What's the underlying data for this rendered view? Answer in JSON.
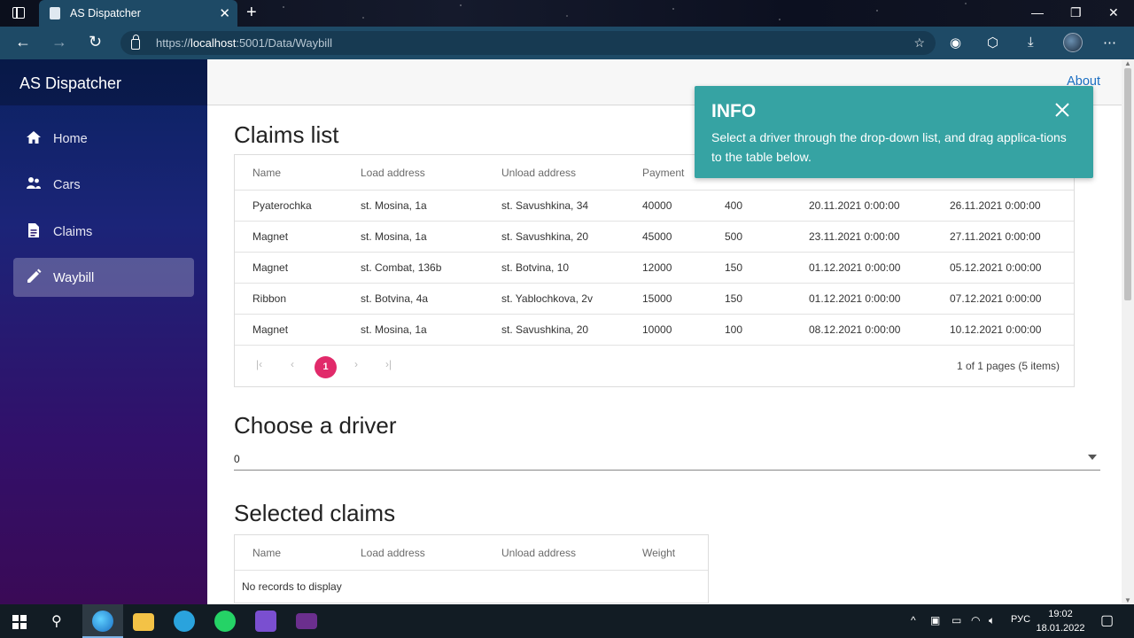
{
  "browser": {
    "tab_title": "AS Dispatcher",
    "url_prefix": "https://",
    "url_host": "localhost",
    "url_rest": ":5001/Data/Waybill"
  },
  "sidebar": {
    "brand": "AS Dispatcher",
    "items": [
      {
        "label": "Home",
        "icon": "home-icon"
      },
      {
        "label": "Cars",
        "icon": "people-icon"
      },
      {
        "label": "Claims",
        "icon": "document-icon"
      },
      {
        "label": "Waybill",
        "icon": "pencil-icon"
      }
    ],
    "active": "Waybill"
  },
  "header": {
    "about": "About"
  },
  "claims": {
    "title": "Claims list",
    "columns": [
      "Name",
      "Load address",
      "Unload address",
      "Payment"
    ],
    "rows": [
      [
        "Pyaterochka",
        "st. Mosina, 1a",
        "st. Savushkina, 34",
        "40000",
        "400",
        "20.11.2021 0:00:00",
        "26.11.2021 0:00:00"
      ],
      [
        "Magnet",
        "st. Mosina, 1a",
        "st. Savushkina, 20",
        "45000",
        "500",
        "23.11.2021 0:00:00",
        "27.11.2021 0:00:00"
      ],
      [
        "Magnet",
        "st. Combat, 136b",
        "st. Botvina, 10",
        "12000",
        "150",
        "01.12.2021 0:00:00",
        "05.12.2021 0:00:00"
      ],
      [
        "Ribbon",
        "st. Botvina, 4a",
        "st. Yablochkova, 2v",
        "15000",
        "150",
        "01.12.2021 0:00:00",
        "07.12.2021 0:00:00"
      ],
      [
        "Magnet",
        "st. Mosina, 1a",
        "st. Savushkina, 20",
        "10000",
        "100",
        "08.12.2021 0:00:00",
        "10.12.2021 0:00:00"
      ]
    ],
    "pager": {
      "current_page": "1",
      "info": "1 of 1 pages (5 items)"
    }
  },
  "driver": {
    "title": "Choose a driver",
    "selected": "0"
  },
  "selected_claims": {
    "title": "Selected claims",
    "columns": [
      "Name",
      "Load address",
      "Unload address",
      "Weight"
    ],
    "empty": "No records to display"
  },
  "toast": {
    "title": "INFO",
    "message": "Select a driver through the drop-down list, and drag applica-tions to the table below."
  },
  "taskbar": {
    "time": "19:02",
    "date": "18.01.2022",
    "lang": "РУС"
  },
  "colors": {
    "accent": "#e12a6a",
    "toast": "#36a3a3",
    "link": "#1b6ec2",
    "browser_bar": "#1e4a66"
  }
}
